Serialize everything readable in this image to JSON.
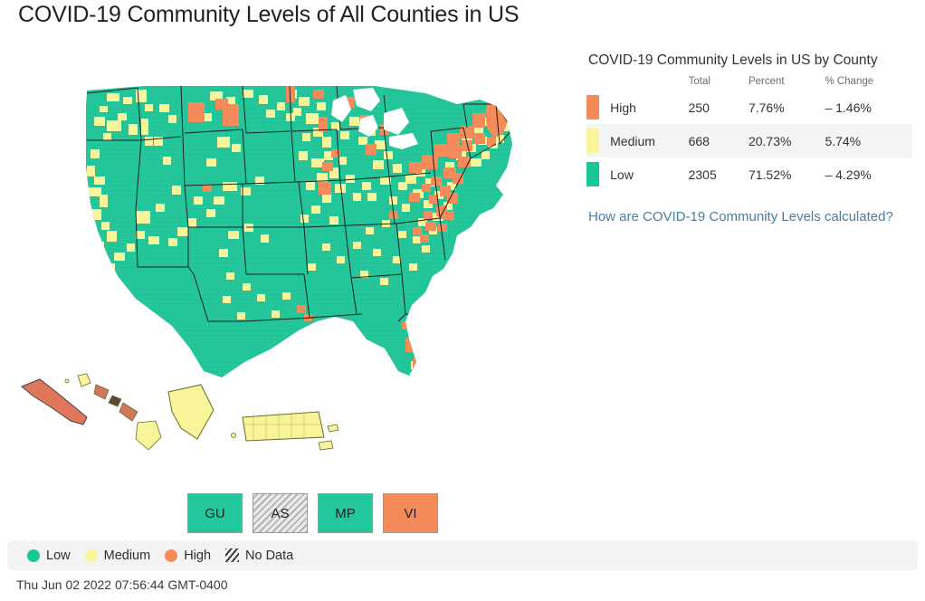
{
  "page_title": "COVID-19 Community Levels of All Counties in US",
  "panel": {
    "title": "COVID-19 Community Levels in US by County",
    "columns": [
      "",
      "",
      "Total",
      "Percent",
      "% Change"
    ],
    "rows": [
      {
        "level": "High",
        "total": "250",
        "percent": "7.76%",
        "change": "– 1.46%",
        "color": "#f58a5a"
      },
      {
        "level": "Medium",
        "total": "668",
        "percent": "20.73%",
        "change": "5.74%",
        "color": "#f7f49a"
      },
      {
        "level": "Low",
        "total": "2305",
        "percent": "71.52%",
        "change": "– 4.29%",
        "color": "#18c894"
      }
    ],
    "calc_link": "How are COVID-19 Community Levels calculated?"
  },
  "territories": [
    {
      "code": "GU",
      "level": "Low",
      "color": "#24c79b"
    },
    {
      "code": "AS",
      "level": "No Data",
      "color": "hatch"
    },
    {
      "code": "MP",
      "level": "Low",
      "color": "#24c79b"
    },
    {
      "code": "VI",
      "level": "High",
      "color": "#f58a5a"
    }
  ],
  "legend": [
    {
      "label": "Low",
      "color": "#18c894",
      "shape": "dot"
    },
    {
      "label": "Medium",
      "color": "#f7f49a",
      "shape": "dot"
    },
    {
      "label": "High",
      "color": "#f58a5a",
      "shape": "dot"
    },
    {
      "label": "No Data",
      "color": "#3a3a3a",
      "shape": "hatch"
    }
  ],
  "timestamp": "Thu Jun 02 2022 07:56:44 GMT-0400",
  "colors": {
    "low": "#24c79b",
    "medium": "#f7f49a",
    "high": "#f58a5a",
    "no_data": "#e9e9e9",
    "state_border": "#1a1a1a",
    "link": "#4d7d9e"
  },
  "map": {
    "name": "us-county-choropleth",
    "insets": [
      "Alaska",
      "Hawaii",
      "District of Columbia",
      "Puerto Rico"
    ]
  }
}
